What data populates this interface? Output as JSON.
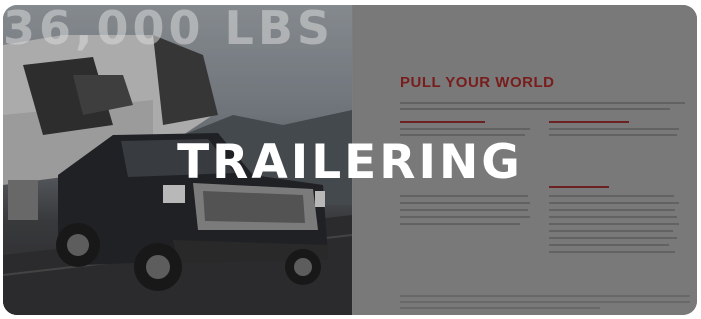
{
  "background_text": "36,000 LBS",
  "page": {
    "title": "PULL YOUR WORLD"
  },
  "headline": "TRAILERING",
  "colors": {
    "accent": "#8a1a1a",
    "overlay": "#8c8c8c"
  }
}
